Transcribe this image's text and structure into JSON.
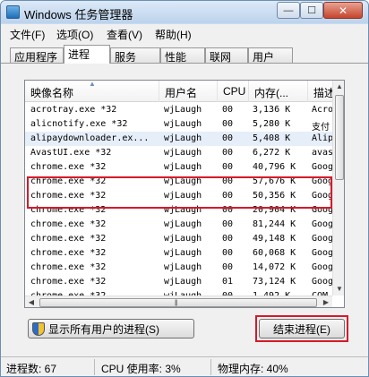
{
  "window": {
    "title": "Windows 任务管理器",
    "min_glyph": "—",
    "max_glyph": "☐",
    "close_glyph": "✕"
  },
  "menu": [
    "文件(F)",
    "选项(O)",
    "查看(V)",
    "帮助(H)"
  ],
  "tabs": [
    "应用程序",
    "进程",
    "服务",
    "性能",
    "联网",
    "用户"
  ],
  "active_tab": "进程",
  "columns": [
    "映像名称",
    "用户名",
    "CPU",
    "内存(...",
    "描述"
  ],
  "processes": [
    {
      "name": "acrotray.exe *32",
      "user": "wjLaugh",
      "cpu": "00",
      "mem": "3,136 K",
      "desc": "Acro"
    },
    {
      "name": "alicnotify.exe *32",
      "user": "wjLaugh",
      "cpu": "00",
      "mem": "5,280 K",
      "desc": "支付"
    },
    {
      "name": "alipaydownloader.ex...",
      "user": "wjLaugh",
      "cpu": "00",
      "mem": "5,408 K",
      "desc": "Alip"
    },
    {
      "name": "AvastUI.exe *32",
      "user": "wjLaugh",
      "cpu": "00",
      "mem": "6,272 K",
      "desc": "avas"
    },
    {
      "name": "chrome.exe *32",
      "user": "wjLaugh",
      "cpu": "00",
      "mem": "40,796 K",
      "desc": "Goog"
    },
    {
      "name": "chrome.exe *32",
      "user": "wjLaugh",
      "cpu": "00",
      "mem": "57,676 K",
      "desc": "Goog"
    },
    {
      "name": "chrome.exe *32",
      "user": "wjLaugh",
      "cpu": "00",
      "mem": "50,356 K",
      "desc": "Goog"
    },
    {
      "name": "chrome.exe *32",
      "user": "wjLaugh",
      "cpu": "00",
      "mem": "20,904 K",
      "desc": "Goog"
    },
    {
      "name": "chrome.exe *32",
      "user": "wjLaugh",
      "cpu": "00",
      "mem": "81,244 K",
      "desc": "Goog"
    },
    {
      "name": "chrome.exe *32",
      "user": "wjLaugh",
      "cpu": "00",
      "mem": "49,148 K",
      "desc": "Goog"
    },
    {
      "name": "chrome.exe *32",
      "user": "wjLaugh",
      "cpu": "00",
      "mem": "60,068 K",
      "desc": "Goog"
    },
    {
      "name": "chrome.exe *32",
      "user": "wjLaugh",
      "cpu": "00",
      "mem": "14,072 K",
      "desc": "Goog"
    },
    {
      "name": "chrome.exe *32",
      "user": "wjLaugh",
      "cpu": "01",
      "mem": "73,124 K",
      "desc": "Goog"
    },
    {
      "name": "chrome.exe *32",
      "user": "wjLaugh",
      "cpu": "00",
      "mem": "1,492 K",
      "desc": "COM"
    }
  ],
  "selected_row": 2,
  "buttons": {
    "show_all": "显示所有用户的进程(S)",
    "end_process": "结束进程(E)"
  },
  "status": {
    "process_count": "进程数: 67",
    "cpu_usage": "CPU 使用率: 3%",
    "memory": "物理内存: 40%"
  },
  "colors": {
    "highlight_red": "#d7192a",
    "selection": "#e6eefa",
    "title_gradient": "#bcd3ec"
  }
}
